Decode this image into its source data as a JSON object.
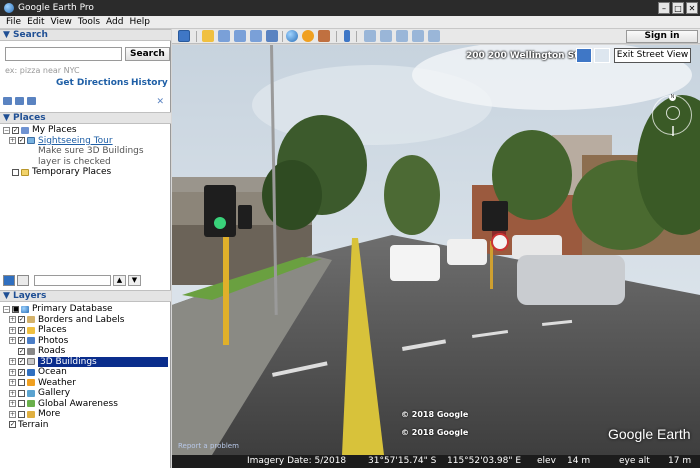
{
  "window": {
    "title": "Google Earth Pro",
    "controls": [
      "–",
      "□",
      "✕"
    ]
  },
  "menu": [
    "File",
    "Edit",
    "View",
    "Tools",
    "Add",
    "Help"
  ],
  "search": {
    "header": "▼ Search",
    "button": "Search",
    "placeholder": "",
    "hint": "ex: pizza near NYC",
    "get_directions": "Get Directions",
    "history": "History",
    "close": "✕"
  },
  "places": {
    "header": "▼ Places",
    "my_places": "My Places",
    "sightseeing_tour": "Sightseeing Tour",
    "note_line1": "Make sure 3D Buildings",
    "note_line2": "layer is checked",
    "temporary_places": "Temporary Places"
  },
  "layers": {
    "header": "▼ Layers",
    "items": [
      {
        "label": "Primary Database",
        "icon": "globe-icon",
        "checked": "partial"
      },
      {
        "label": "Borders and Labels",
        "icon": "borders-icon",
        "checked": true
      },
      {
        "label": "Places",
        "icon": "places-icon",
        "checked": true
      },
      {
        "label": "Photos",
        "icon": "photos-icon",
        "checked": true
      },
      {
        "label": "Roads",
        "icon": "roads-icon",
        "checked": true
      },
      {
        "label": "3D Buildings",
        "icon": "buildings-icon",
        "checked": true,
        "selected": true
      },
      {
        "label": "Ocean",
        "icon": "ocean-icon",
        "checked": true
      },
      {
        "label": "Weather",
        "icon": "weather-icon",
        "checked": false
      },
      {
        "label": "Gallery",
        "icon": "gallery-icon",
        "checked": false
      },
      {
        "label": "Global Awareness",
        "icon": "global-awareness-icon",
        "checked": false
      },
      {
        "label": "More",
        "icon": "more-icon",
        "checked": false
      }
    ],
    "terrain": "Terrain"
  },
  "toolbar": {
    "sign_in": "Sign in"
  },
  "streetview": {
    "address": "200 200 Wellington St",
    "exit_label": "Exit Street View",
    "compass_n": "N",
    "copyright1": "© 2018 Google",
    "copyright2": "© 2018 Google",
    "report": "Report a problem",
    "logo": "Google Earth"
  },
  "status": {
    "imagery_date": "Imagery Date: 5/2018",
    "lat": "31°57'15.74\" S",
    "lon": "115°52'03.98\" E",
    "elev_label": "elev",
    "elev": "14 m",
    "eye_alt_label": "eye alt",
    "eye_alt": "17 m"
  },
  "colors": {
    "selection": "#0a2d8c",
    "section_header": "#1f4f94",
    "link": "#1f5fa6"
  }
}
